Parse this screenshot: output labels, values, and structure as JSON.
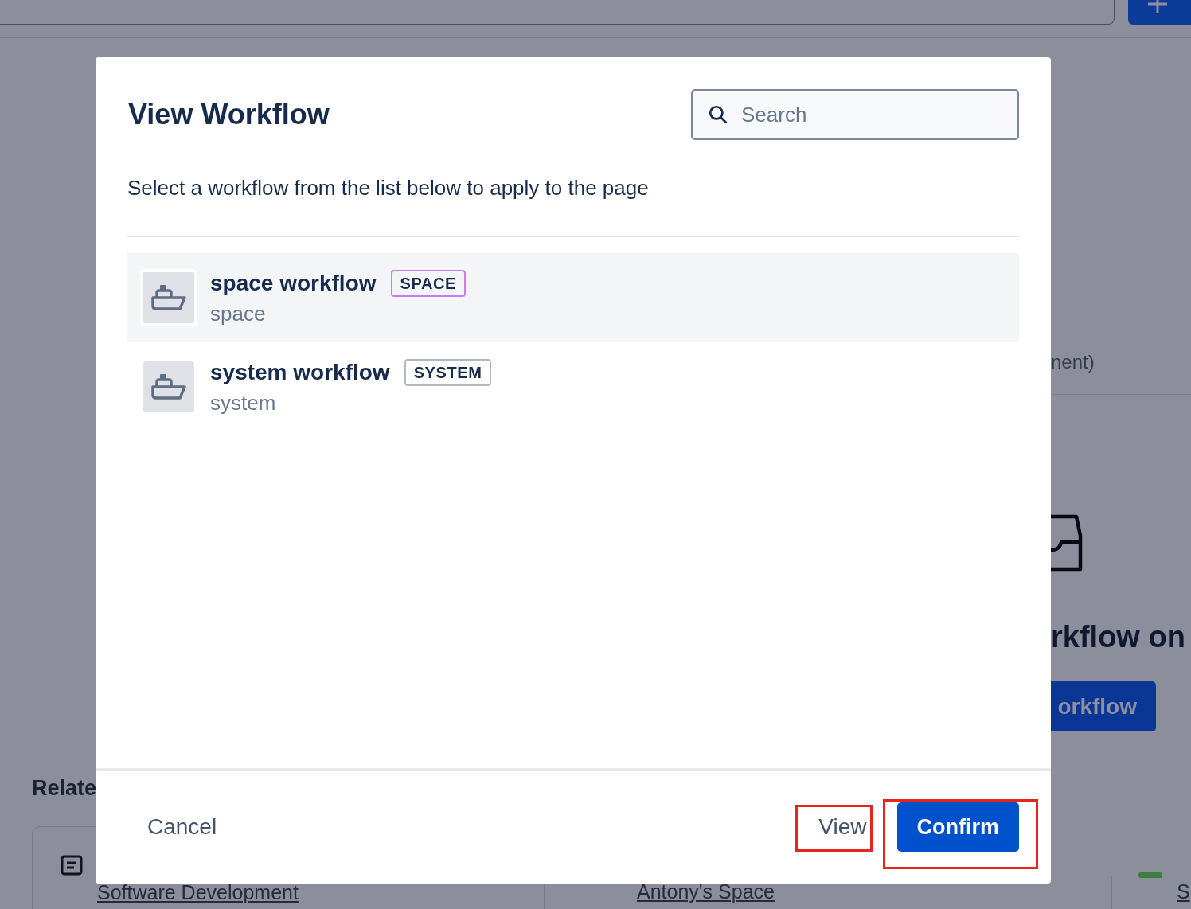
{
  "background": {
    "side_panel": {
      "caption": "nent)",
      "heading": "rkflow on",
      "button": "orkflow"
    },
    "related": {
      "heading": "Relate",
      "cards": [
        {
          "link": "Software Development"
        },
        {
          "link": "Antony's Space"
        },
        {
          "link": "S"
        }
      ]
    }
  },
  "dialog": {
    "title": "View Workflow",
    "search": {
      "placeholder": "Search"
    },
    "description": "Select a workflow from the list below to apply to the page",
    "workflows": [
      {
        "name": "space workflow",
        "badge": "SPACE",
        "color": "#c57df2",
        "scope": "space",
        "selected": true
      },
      {
        "name": "system workflow",
        "badge": "SYSTEM",
        "color": "#b3b9c4",
        "scope": "system",
        "selected": false
      }
    ],
    "buttons": [
      {
        "label": "Cancel",
        "kind": "subtle",
        "highlighted": false
      },
      {
        "label": "View",
        "kind": "subtle",
        "highlighted": true
      },
      {
        "label": "Confirm",
        "kind": "primary",
        "highlighted": true
      }
    ]
  }
}
